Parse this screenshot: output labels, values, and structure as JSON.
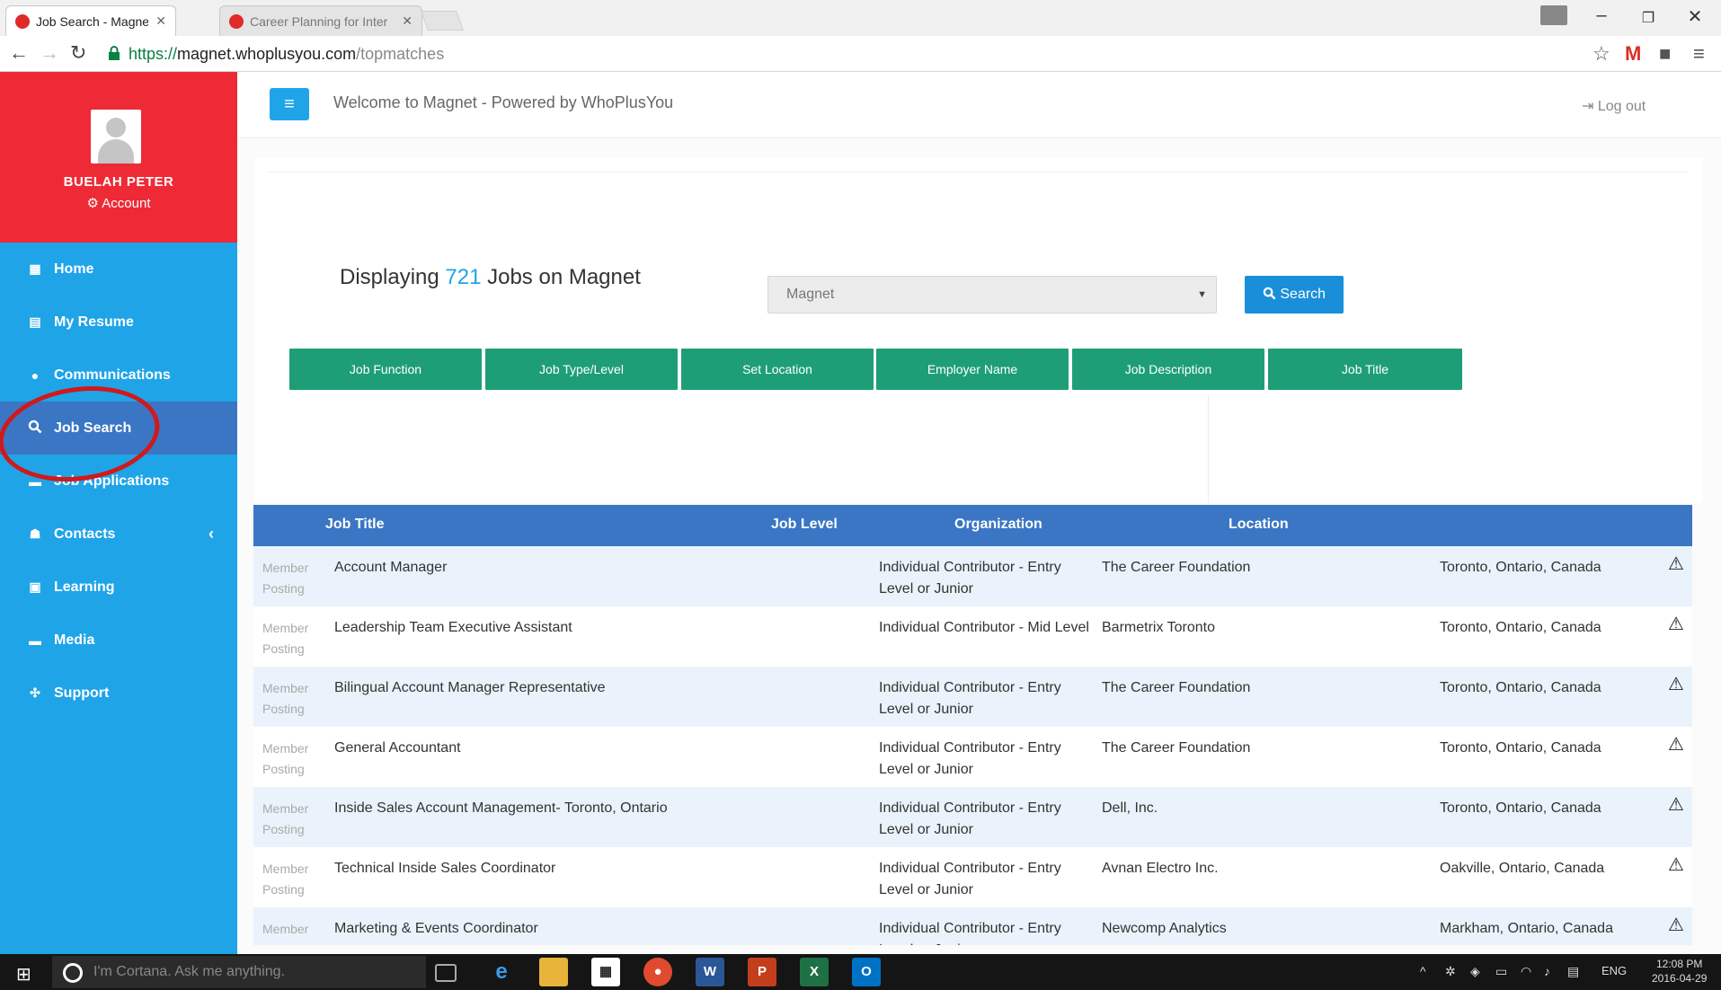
{
  "browser": {
    "tabs": [
      {
        "title": "Job Search - Magnet - Wi",
        "active": true
      },
      {
        "title": "Career Planning for Inter",
        "active": false
      }
    ],
    "url_scheme": "https://",
    "url_host": "magnet.whoplusyou.com",
    "url_path": "/topmatches"
  },
  "sidebar": {
    "user_name": "BUELAH PETER",
    "account_label": "Account",
    "items": [
      {
        "label": "Home",
        "icon": "dashboard-icon",
        "active": false
      },
      {
        "label": "My Resume",
        "icon": "document-icon",
        "active": false
      },
      {
        "label": "Communications",
        "icon": "comments-icon",
        "active": false
      },
      {
        "label": "Job Search",
        "icon": "search-icon",
        "active": true
      },
      {
        "label": "Job Applications",
        "icon": "folder-icon",
        "active": false
      },
      {
        "label": "Contacts",
        "icon": "users-icon",
        "active": false,
        "has_chevron": true
      },
      {
        "label": "Learning",
        "icon": "learning-icon",
        "active": false
      },
      {
        "label": "Media",
        "icon": "folder-icon",
        "active": false
      },
      {
        "label": "Support",
        "icon": "support-icon",
        "active": false
      }
    ],
    "colors": {
      "profile_bg": "#ee2a37",
      "nav_bg": "#1fa4e8",
      "active_bg": "#3a76c4"
    }
  },
  "header": {
    "welcome": "Welcome to Magnet - Powered by WhoPlusYou",
    "logout": "Log out"
  },
  "search": {
    "displaying_prefix": "Displaying",
    "count": "721",
    "displaying_suffix": "Jobs on Magnet",
    "source_selected": "Magnet",
    "search_button": "Search",
    "filters": [
      "Job Function",
      "Job Type/Level",
      "Set Location",
      "Employer Name",
      "Job Description",
      "Job Title"
    ]
  },
  "table": {
    "headers": {
      "title": "Job Title",
      "level": "Job Level",
      "org": "Organization",
      "location": "Location"
    },
    "rows": [
      {
        "source": "Member Posting",
        "title": "Account Manager",
        "level": "Individual Contributor - Entry Level or Junior",
        "org": "The Career Foundation",
        "location": "Toronto, Ontario, Canada"
      },
      {
        "source": "Member Posting",
        "title": "Leadership Team Executive Assistant",
        "level": "Individual Contributor - Mid Level",
        "org": "Barmetrix Toronto",
        "location": "Toronto, Ontario, Canada"
      },
      {
        "source": "Member Posting",
        "title": "Bilingual Account Manager Representative",
        "level": "Individual Contributor - Entry Level or Junior",
        "org": "The Career Foundation",
        "location": "Toronto, Ontario, Canada"
      },
      {
        "source": "Member Posting",
        "title": "General Accountant",
        "level": "Individual Contributor - Entry Level or Junior",
        "org": "The Career Foundation",
        "location": "Toronto, Ontario, Canada"
      },
      {
        "source": "Member Posting",
        "title": "Inside Sales Account Management- Toronto, Ontario",
        "level": "Individual Contributor - Entry Level or Junior",
        "org": "Dell, Inc.",
        "location": "Toronto, Ontario, Canada"
      },
      {
        "source": "Member Posting",
        "title": "Technical Inside Sales Coordinator",
        "level": "Individual Contributor - Entry Level or Junior",
        "org": "Avnan Electro Inc.",
        "location": "Oakville, Ontario, Canada"
      },
      {
        "source": "Member Posting",
        "title": "Marketing & Events Coordinator",
        "level": "Individual Contributor - Entry Level or Junior",
        "org": "Newcomp Analytics",
        "location": "Markham, Ontario, Canada"
      }
    ],
    "alert_icon": "warning-icon",
    "colors": {
      "header_bg": "#3a76c4",
      "shade_row": "#eaf3fb"
    }
  },
  "taskbar": {
    "cortana_placeholder": "I'm Cortana. Ask me anything.",
    "apps": [
      "Task View",
      "Edge",
      "File Explorer",
      "Store",
      "Chrome",
      "Word",
      "PowerPoint",
      "Excel",
      "Outlook"
    ],
    "language": "ENG",
    "time": "12:08 PM",
    "date": "2016-04-29"
  },
  "colors": {
    "accent_blue": "#1fa4e8",
    "filter_green": "#1e9e77",
    "annotation_red": "#d0191a"
  }
}
